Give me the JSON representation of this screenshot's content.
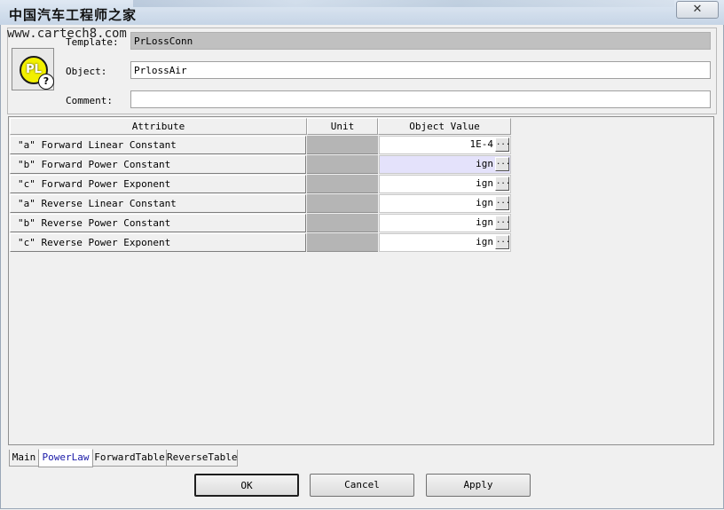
{
  "watermark": {
    "site_name": "中国汽车工程师之家",
    "url": "www.cartech8.com"
  },
  "window": {
    "close_glyph": "✕"
  },
  "header": {
    "template_label": "Template:",
    "template_value": "PrLossConn",
    "object_label": "Object:",
    "object_value": "PrlossAir",
    "comment_label": "Comment:",
    "comment_value": "",
    "icon_text": "PL",
    "icon_badge": "?"
  },
  "grid": {
    "columns": [
      "Attribute",
      "Unit",
      "Object Value"
    ],
    "rows": [
      {
        "attribute": "\"a\" Forward Linear Constant",
        "unit": "",
        "value": "1E-4"
      },
      {
        "attribute": "\"b\" Forward Power Constant",
        "unit": "",
        "value": "ign"
      },
      {
        "attribute": "\"c\" Forward Power Exponent",
        "unit": "",
        "value": "ign"
      },
      {
        "attribute": "\"a\" Reverse Linear Constant",
        "unit": "",
        "value": "ign"
      },
      {
        "attribute": "\"b\" Reverse Power Constant",
        "unit": "",
        "value": "ign"
      },
      {
        "attribute": "\"c\" Reverse Power Exponent",
        "unit": "",
        "value": "ign"
      }
    ],
    "ellipsis": "..."
  },
  "tabs": [
    {
      "label": "Main"
    },
    {
      "label": "PowerLaw"
    },
    {
      "label": "ForwardTable"
    },
    {
      "label": "ReverseTable"
    }
  ],
  "active_tab": "PowerLaw",
  "buttons": {
    "ok": "OK",
    "cancel": "Cancel",
    "apply": "Apply"
  }
}
